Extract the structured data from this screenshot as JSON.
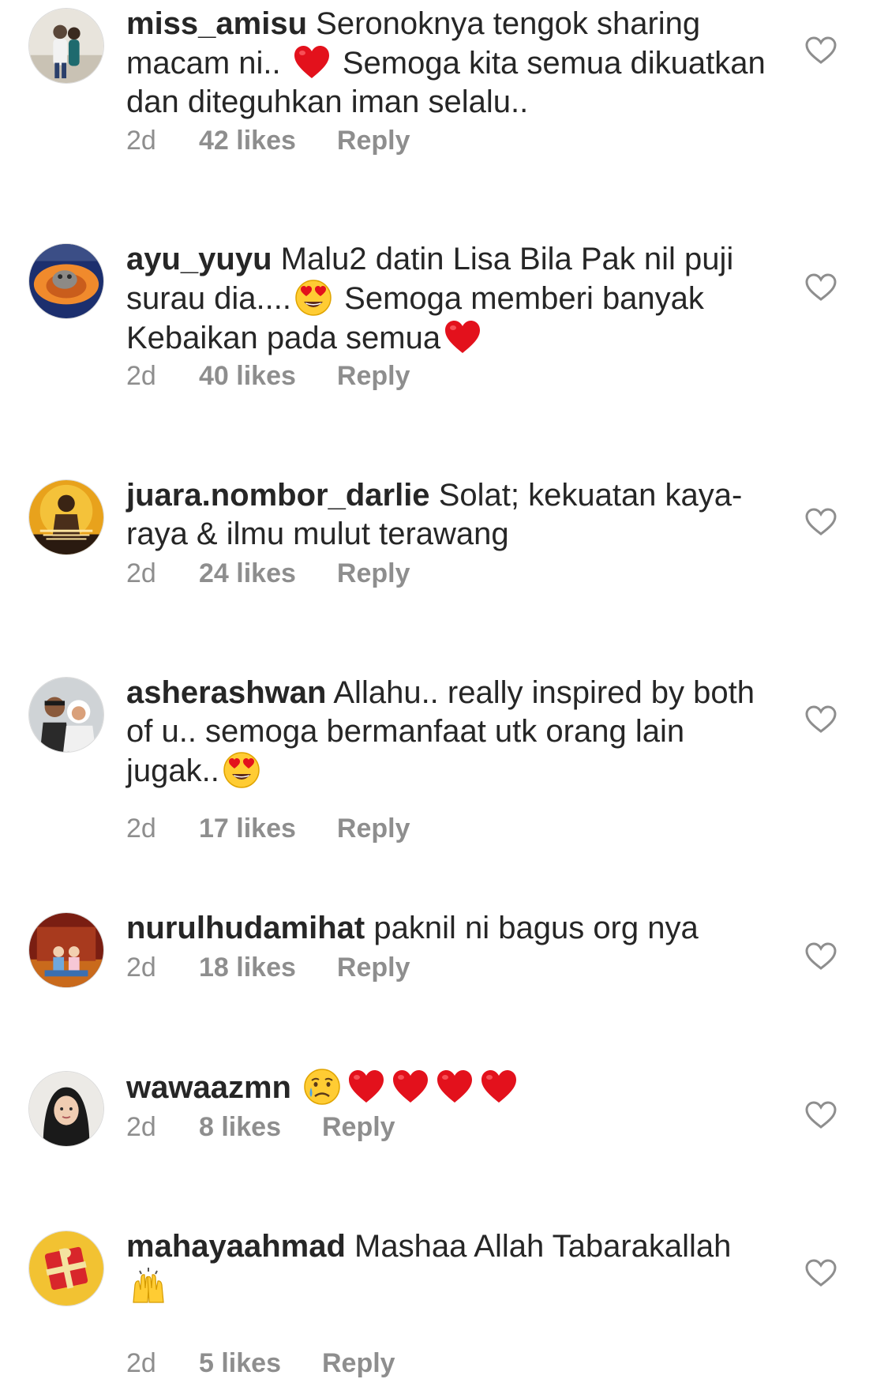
{
  "comments": [
    {
      "username": "miss_amisu",
      "text_1": "Seronoknya tengok sharing macam ni..",
      "emoji_1": "red-heart",
      "text_2": "Semoga kita semua dikuatkan dan diteguhkan iman selalu..",
      "time": "2d",
      "likes": "42 likes",
      "reply": "Reply"
    },
    {
      "username": "ayu_yuyu",
      "text_1": "Malu2 datin Lisa Bila Pak nil puji surau dia....",
      "emoji_1": "heart-eyes",
      "text_2": "Semoga memberi banyak Kebaikan pada semua",
      "emoji_2": "red-heart",
      "time": "2d",
      "likes": "40 likes",
      "reply": "Reply"
    },
    {
      "username": "juara.nombor_darlie",
      "text_1": "Solat; kekuatan kaya-raya & ilmu mulut terawang",
      "time": "2d",
      "likes": "24 likes",
      "reply": "Reply"
    },
    {
      "username": "asherashwan",
      "text_1": "Allahu.. really inspired by both of u.. semoga bermanfaat utk orang lain jugak..",
      "emoji_1": "heart-eyes",
      "time": "2d",
      "likes": "17 likes",
      "reply": "Reply"
    },
    {
      "username": "nurulhudamihat",
      "text_1": "paknil ni bagus org nya",
      "time": "2d",
      "likes": "18 likes",
      "reply": "Reply"
    },
    {
      "username": "wawaazmn",
      "emojis": [
        "crying-face",
        "red-heart",
        "red-heart",
        "red-heart",
        "red-heart"
      ],
      "time": "2d",
      "likes": "8 likes",
      "reply": "Reply"
    },
    {
      "username": "mahayaahmad",
      "text_1": "Mashaa Allah Tabarakallah",
      "emoji_1": "raising-hands",
      "time": "2d",
      "likes": "5 likes",
      "reply": "Reply"
    }
  ],
  "colors": {
    "text": "#262626",
    "secondary": "#8e8e8e",
    "heart_outline": "#8e8e8e"
  }
}
